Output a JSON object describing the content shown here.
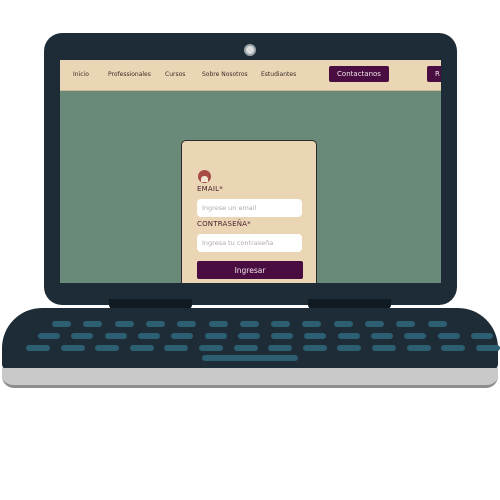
{
  "nav": {
    "links": [
      "Inicio",
      "Professionales",
      "Cursos",
      "Sobre Nosotros",
      "Estudiantes"
    ],
    "cta": "Contactanos",
    "overflow_button": "R"
  },
  "login": {
    "email_label": "EMAIL*",
    "email_placeholder": "Ingrese un email",
    "password_label": "CONTRASEÑA*",
    "password_placeholder": "Ingresa tu contraseña",
    "submit": "Ingresar"
  },
  "colors": {
    "nav_bg": "#ead6b4",
    "accent": "#4a0d42",
    "page_bg": "#698a79",
    "laptop_body": "#1d2c36",
    "key_color": "#2d5f73"
  }
}
